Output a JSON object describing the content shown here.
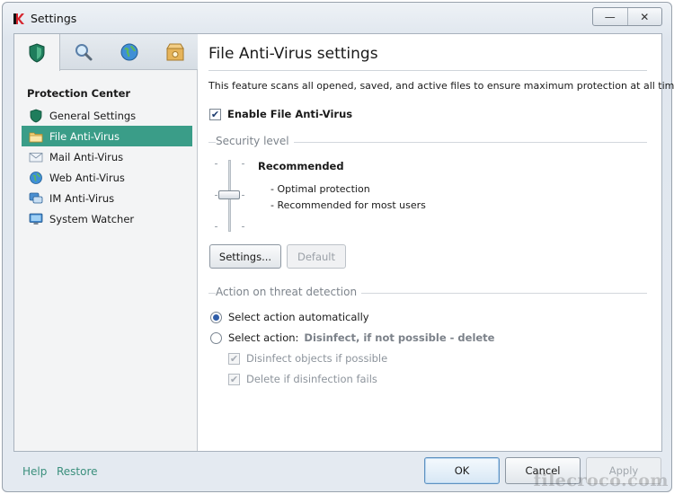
{
  "window": {
    "title": "Settings",
    "minimize_glyph": "—",
    "close_glyph": "✕"
  },
  "tabs": [
    {
      "icon": "shield-icon",
      "active": true
    },
    {
      "icon": "magnifier-icon",
      "active": false
    },
    {
      "icon": "globe-icon",
      "active": false
    },
    {
      "icon": "box-gear-icon",
      "active": false
    }
  ],
  "sidebar": {
    "heading": "Protection Center",
    "items": [
      {
        "label": "General Settings",
        "icon": "shield-icon",
        "selected": false
      },
      {
        "label": "File Anti-Virus",
        "icon": "folder-icon",
        "selected": true
      },
      {
        "label": "Mail Anti-Virus",
        "icon": "envelope-icon",
        "selected": false
      },
      {
        "label": "Web Anti-Virus",
        "icon": "globe-icon",
        "selected": false
      },
      {
        "label": "IM Anti-Virus",
        "icon": "chat-icon",
        "selected": false
      },
      {
        "label": "System Watcher",
        "icon": "monitor-icon",
        "selected": false
      }
    ]
  },
  "main": {
    "title": "File Anti-Virus settings",
    "description": "This feature scans all opened, saved, and active files to ensure maximum protection at all times.",
    "enable_label": "Enable File Anti-Virus",
    "enable_checked": true,
    "security_level": {
      "section_label": "Security level",
      "level_name": "Recommended",
      "lines": [
        "- Optimal protection",
        "- Recommended for most users"
      ],
      "level_position": "2 of 3"
    },
    "settings_button": "Settings...",
    "default_button": "Default",
    "action": {
      "section_label": "Action on threat detection",
      "auto_label": "Select action automatically",
      "manual_label": "Select action:",
      "manual_value": "Disinfect, if not possible - delete",
      "disinfect_label": "Disinfect objects if possible",
      "delete_label": "Delete if disinfection fails"
    }
  },
  "footer": {
    "help": "Help",
    "restore": "Restore",
    "ok": "OK",
    "cancel": "Cancel",
    "apply": "Apply"
  },
  "watermark": "filecroco.com",
  "colors": {
    "selected_item": "#3a9d88",
    "link": "#3a8f7c",
    "brand_red": "#d6262f"
  }
}
